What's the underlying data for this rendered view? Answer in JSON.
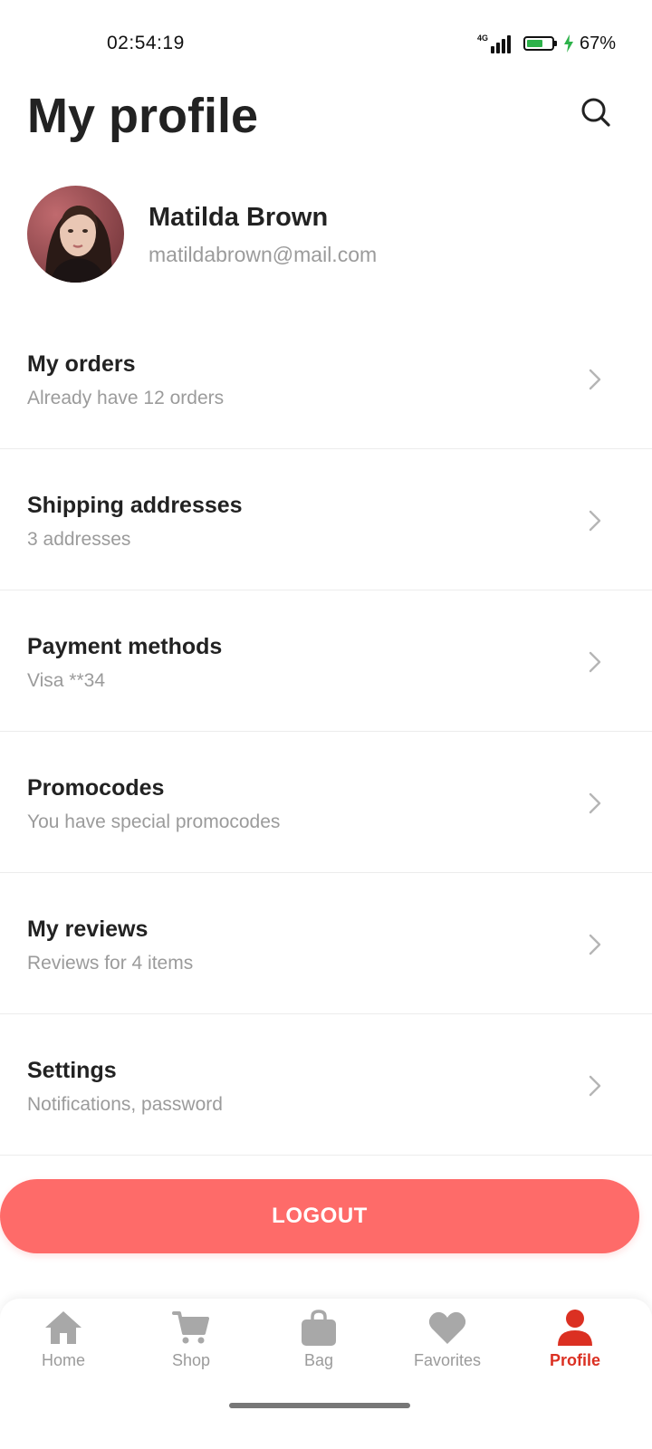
{
  "status_bar": {
    "time": "02:54:19",
    "network": "4G",
    "battery_percent": "67%",
    "battery_level": 0.67,
    "battery_color": "#2db24a"
  },
  "header": {
    "title": "My profile",
    "search_icon": "search-icon"
  },
  "profile": {
    "name": "Matilda Brown",
    "email": "matildabrown@mail.com"
  },
  "menu": {
    "items": [
      {
        "title": "My orders",
        "subtitle": "Already have 12 orders"
      },
      {
        "title": "Shipping addresses",
        "subtitle": "3 addresses"
      },
      {
        "title": "Payment methods",
        "subtitle": "Visa  **34"
      },
      {
        "title": "Promocodes",
        "subtitle": "You have special promocodes"
      },
      {
        "title": "My reviews",
        "subtitle": "Reviews for 4 items"
      },
      {
        "title": "Settings",
        "subtitle": "Notifications, password"
      }
    ]
  },
  "logout": {
    "label": "LOGOUT",
    "color": "#fe6b69"
  },
  "bottom_nav": {
    "items": [
      {
        "label": "Home",
        "icon": "home-icon"
      },
      {
        "label": "Shop",
        "icon": "cart-icon"
      },
      {
        "label": "Bag",
        "icon": "bag-icon"
      },
      {
        "label": "Favorites",
        "icon": "heart-icon"
      },
      {
        "label": "Profile",
        "icon": "person-icon"
      }
    ],
    "active": "Profile",
    "active_color": "#db3022",
    "inactive_color": "#9b9b9b"
  }
}
